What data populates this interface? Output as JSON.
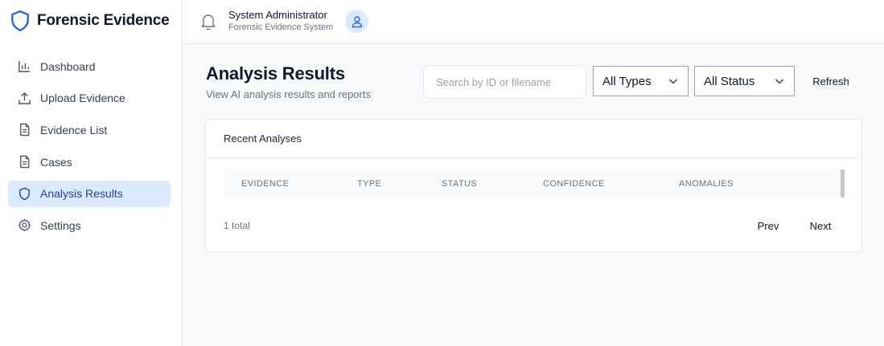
{
  "brand": {
    "title": "Forensic Evidence",
    "icon": "shield-icon",
    "color": "#2563eb"
  },
  "sidebar": {
    "items": [
      {
        "label": "Dashboard",
        "icon": "bar-chart-icon",
        "active": false
      },
      {
        "label": "Upload Evidence",
        "icon": "upload-icon",
        "active": false
      },
      {
        "label": "Evidence List",
        "icon": "document-icon",
        "active": false
      },
      {
        "label": "Cases",
        "icon": "document-icon",
        "active": false
      },
      {
        "label": "Analysis Results",
        "icon": "shield-icon",
        "active": true
      },
      {
        "label": "Settings",
        "icon": "gear-icon",
        "active": false
      }
    ]
  },
  "topbar": {
    "user_name": "System Administrator",
    "user_subtitle": "Forensic Evidence System"
  },
  "page": {
    "title": "Analysis Results",
    "subtitle": "View AI analysis results and reports"
  },
  "filters": {
    "search_placeholder": "Search by ID or filename",
    "search_value": "",
    "type_selected": "All Types",
    "status_selected": "All Status",
    "refresh_label": "Refresh"
  },
  "card": {
    "title": "Recent Analyses",
    "columns": [
      "EVIDENCE",
      "TYPE",
      "STATUS",
      "CONFIDENCE",
      "ANOMALIES"
    ],
    "rows": [],
    "total_text": "1 total",
    "prev_label": "Prev",
    "next_label": "Next"
  },
  "colors": {
    "accent": "#2563eb",
    "active_bg": "#dbeafe",
    "active_text": "#1e40af"
  }
}
